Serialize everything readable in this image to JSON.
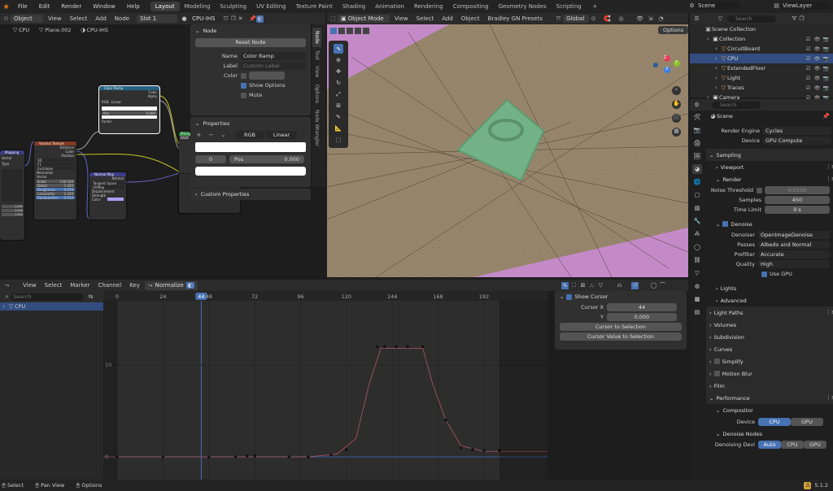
{
  "topbar": {
    "menus": [
      "File",
      "Edit",
      "Render",
      "Window",
      "Help"
    ],
    "workspaces": [
      "Layout",
      "Modeling",
      "Sculpting",
      "UV Editing",
      "Texture Paint",
      "Shading",
      "Animation",
      "Rendering",
      "Compositing",
      "Geometry Nodes",
      "Scripting"
    ],
    "active_workspace": "Layout",
    "scene": "Scene",
    "view_layer": "ViewLayer"
  },
  "node_editor": {
    "header_mode": "Object",
    "menus": [
      "View",
      "Select",
      "Add",
      "Node"
    ],
    "slot": "Slot 1",
    "material": "CPU-IHS",
    "breadcrumb": [
      "CPU",
      "Plane.002",
      "CPU-IHS"
    ],
    "nodes": {
      "color_ramp": "Color Ramp",
      "color": "Color",
      "alpha": "Alpha",
      "rgb": "RGB",
      "linear": "Linear",
      "pos": "Pos",
      "pos_val": "0.000",
      "factor": "Factor",
      "voronoi": "Voronoi Texture",
      "distance": "Distance",
      "color2": "Color",
      "position": "Position",
      "three_d": "3D",
      "f1": "F1",
      "euclidean": "Euclidean",
      "normalize": "Normalize",
      "vector": "Vector",
      "scale": "Scale",
      "scale_val": "118.520",
      "detail": "Detail",
      "detail_val": "7.420",
      "roughness": "Roughness",
      "rough_val": "0.470",
      "lacunarity": "Lacunarity",
      "lac_val": "2.320",
      "randomness": "Randomness",
      "rand_val": "0.912",
      "normal_map": "Normal Map",
      "normal": "Normal",
      "tangent_space": "Tangent Space",
      "uvmap": "UVMap",
      "displacement": "Displacement",
      "strength": "Strength",
      "color3": "Color",
      "mapping": "Mapping",
      "vector2": "Vector",
      "type": "Type",
      "bsdf": "Principled BSDF",
      "val1": "1.000",
      "val2": "1.000",
      "val3": "1.000"
    }
  },
  "node_panel": {
    "tabs": [
      "Node",
      "Tool",
      "View",
      "Options",
      "Node Wrangler"
    ],
    "section_node": "Node",
    "reset": "Reset Node",
    "name_label": "Name",
    "name_value": "Color Ramp",
    "label_label": "Label",
    "label_placeholder": "Custom Label",
    "color_label": "Color",
    "show_options": "Show Options",
    "mute": "Mute",
    "section_properties": "Properties",
    "rgb": "RGB",
    "linear": "Linear",
    "index": "0",
    "pos": "Pos",
    "pos_value": "0.000",
    "custom_props": "Custom Properties"
  },
  "viewport": {
    "mode": "Object Mode",
    "menus": [
      "View",
      "Select",
      "Add",
      "Object",
      "Bradley GN Presets"
    ],
    "orientation": "Global",
    "options": "Options",
    "axis": {
      "x": "X",
      "y": "Y",
      "z": "Z"
    }
  },
  "outliner": {
    "search_placeholder": "Search",
    "scene_collection": "Scene Collection",
    "items": [
      {
        "label": "Collection",
        "indent": 0
      },
      {
        "label": "CircuitBoard",
        "indent": 1
      },
      {
        "label": "CPU",
        "indent": 1,
        "selected": true
      },
      {
        "label": "ExtendedFloor",
        "indent": 1
      },
      {
        "label": "Light",
        "indent": 1
      },
      {
        "label": "Traces",
        "indent": 1
      },
      {
        "label": "Camera",
        "indent": 0
      }
    ]
  },
  "properties": {
    "search_placeholder": "Search",
    "scene": "Scene",
    "render_engine_label": "Render Engine",
    "render_engine": "Cycles",
    "device_label": "Device",
    "device": "GPU Compute",
    "sampling": "Sampling",
    "viewport": "Viewport",
    "render": "Render",
    "noise_threshold": "Noise Threshold",
    "noise_value": "0.0100",
    "samples_label": "Samples",
    "samples": "450",
    "time_limit_label": "Time Limit",
    "time_limit": "0 s",
    "denoise": "Denoise",
    "denoiser_label": "Denoiser",
    "denoiser": "OpenImageDenoise",
    "passes_label": "Passes",
    "passes": "Albedo and Normal",
    "prefilter_label": "Prefilter",
    "prefilter": "Accurate",
    "quality_label": "Quality",
    "quality": "High",
    "use_gpu": "Use GPU",
    "lights": "Lights",
    "advanced": "Advanced",
    "light_paths": "Light Paths",
    "volumes": "Volumes",
    "subdivision": "Subdivision",
    "curves": "Curves",
    "simplify": "Simplify",
    "motion_blur": "Motion Blur",
    "film": "Film",
    "performance": "Performance",
    "compositor": "Compositor",
    "comp_device_label": "Device",
    "cpu": "CPU",
    "gpu": "GPU",
    "denoise_nodes": "Denoise Nodes",
    "denoising_device": "Denoising Devi",
    "auto": "Auto",
    "cpu2": "CPU",
    "gpu2": "GPU"
  },
  "graph_editor": {
    "menus": [
      "View",
      "Select",
      "Marker",
      "Channel",
      "Key"
    ],
    "normalize": "Normalize",
    "search_placeholder": "Search",
    "channel": "CPU",
    "frame_ticks": [
      "0",
      "24",
      "44",
      "48",
      "72",
      "96",
      "120",
      "144",
      "168",
      "192"
    ],
    "current_frame": "44",
    "y_ticks": [
      "10",
      "0"
    ],
    "show_cursor": "Show Cursor",
    "cursor_x_label": "Cursor X",
    "cursor_x": "44",
    "y_label": "Y",
    "cursor_y": "0.000",
    "cursor_to_selection": "Cursor to Selection",
    "cursor_value_to_selection": "Cursor Value to Selection"
  },
  "statusbar": {
    "select": "Select",
    "pan_view": "Pan View",
    "options": "Options",
    "version": "5.1.2"
  }
}
